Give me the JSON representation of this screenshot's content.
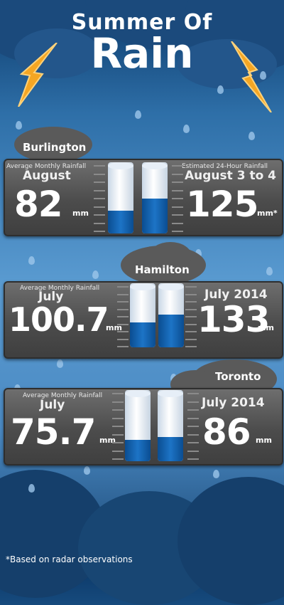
{
  "header": {
    "line1": "Summer Of",
    "line2": "Rain"
  },
  "footer": {
    "note": "*Based on radar observations"
  },
  "colors": {
    "fill": "#1d74c6",
    "panel": "#4c4c4c",
    "bolt": "#f5a623"
  },
  "chart_data": [
    {
      "type": "bar",
      "city": "Burlington",
      "left": {
        "caption": "Average Monthly Rainfall",
        "period": "August",
        "value": "82",
        "unit": "mm"
      },
      "right": {
        "caption": "Estimated 24-Hour Rainfall",
        "period": "August 3 to 4",
        "value": "125",
        "unit": "mm*"
      },
      "values": [
        82,
        125
      ],
      "ylim": [
        0,
        235
      ]
    },
    {
      "type": "bar",
      "city": "Hamilton",
      "left": {
        "caption": "Average Monthly Rainfall",
        "period": "July",
        "value": "100.7",
        "unit": "mm"
      },
      "right": {
        "caption": "",
        "period": "July 2014",
        "value": "133",
        "unit": "mm"
      },
      "values": [
        100.7,
        133
      ],
      "ylim": [
        0,
        235
      ]
    },
    {
      "type": "bar",
      "city": "Toronto",
      "left": {
        "caption": "Average Monthly Rainfall",
        "period": "July",
        "value": "75.7",
        "unit": "mm"
      },
      "right": {
        "caption": "",
        "period": "July 2014",
        "value": "86",
        "unit": "mm"
      },
      "values": [
        75.7,
        86
      ],
      "ylim": [
        0,
        235
      ]
    }
  ]
}
